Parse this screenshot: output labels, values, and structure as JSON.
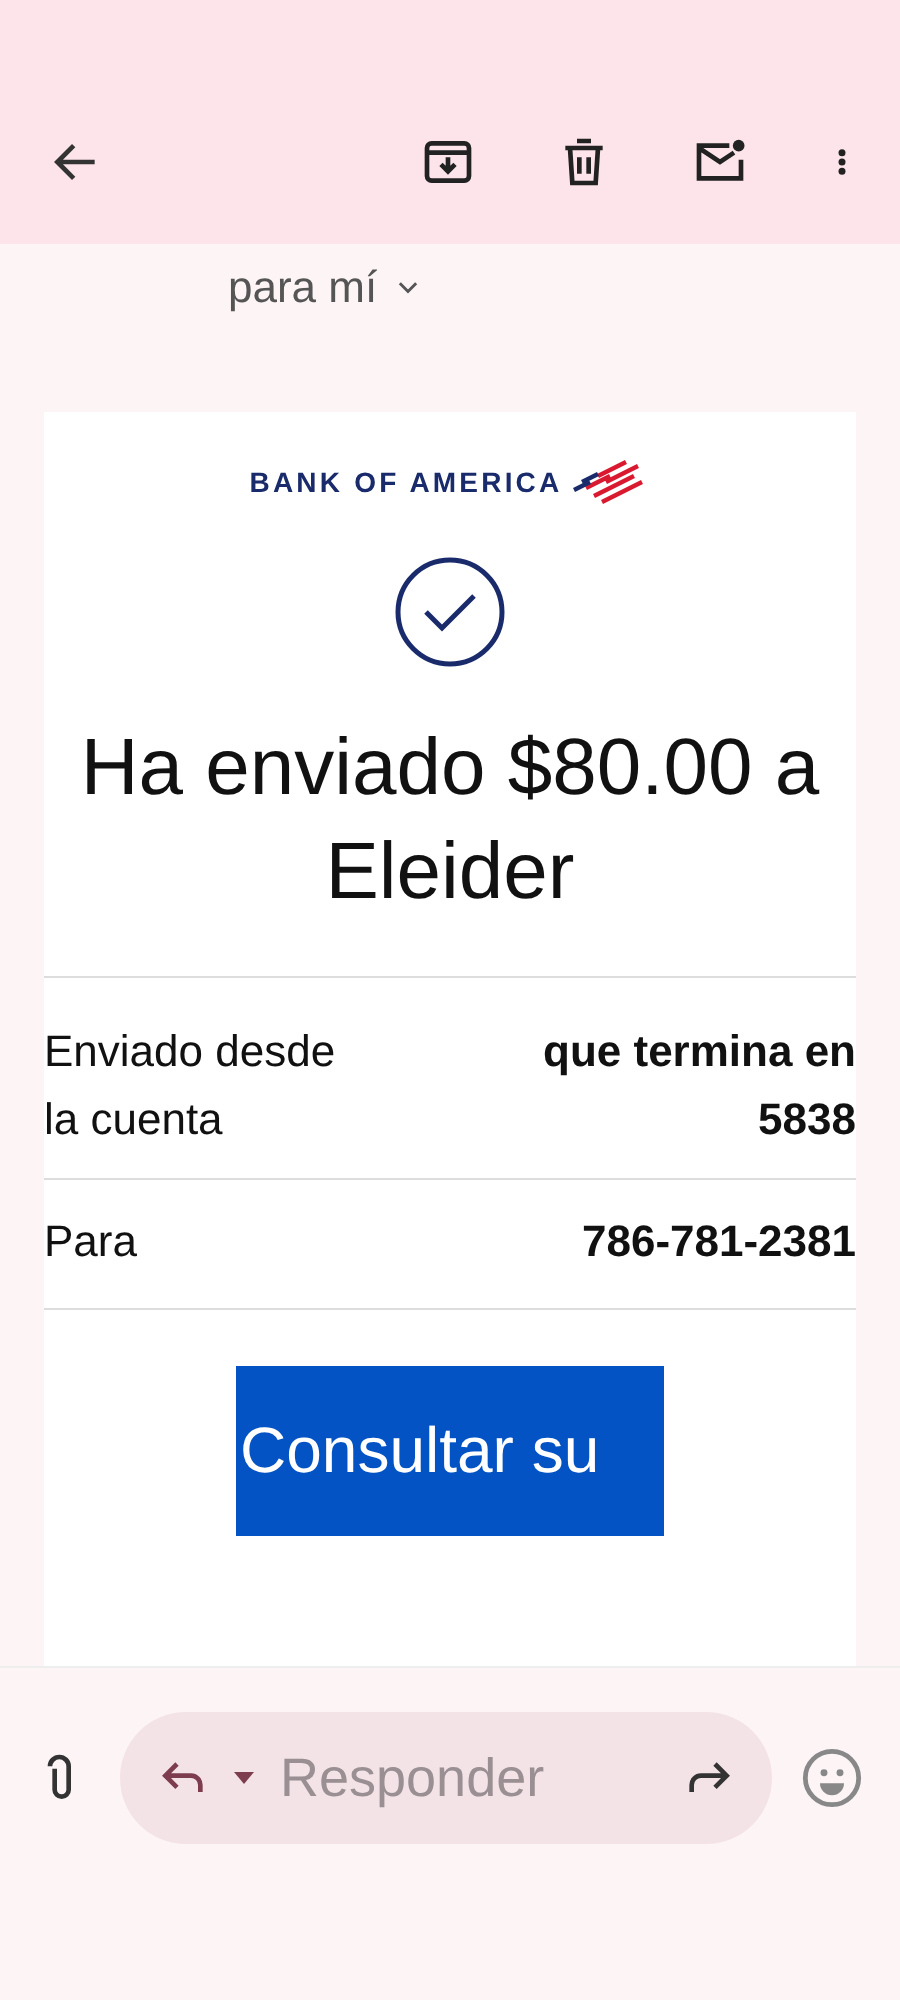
{
  "recipient_line": {
    "label": "para mí"
  },
  "email": {
    "brand": "BANK OF AMERICA",
    "headline": "Ha enviado $80.00 a Eleider",
    "details": [
      {
        "label": "Enviado desde la cuenta",
        "value": "que termina en 5838"
      },
      {
        "label": "Para",
        "value": "786-781-2381"
      }
    ],
    "button": "Consultar su"
  },
  "reply_bar": {
    "placeholder": "Responder"
  }
}
